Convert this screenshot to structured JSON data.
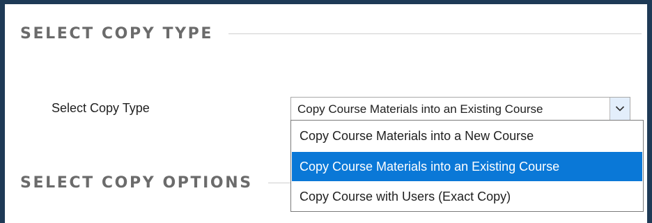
{
  "sections": {
    "copy_type_title": "SELECT COPY TYPE",
    "copy_options_title": "SELECT COPY OPTIONS"
  },
  "copy_type": {
    "label": "Select Copy Type",
    "selected_value": "Copy Course Materials into an Existing Course",
    "options": [
      "Copy Course Materials into a New Course",
      "Copy Course Materials into an Existing Course",
      "Copy Course with Users (Exact Copy)"
    ],
    "selected_index": 1
  },
  "icons": {
    "dropdown_arrow": "chevron-down-icon"
  },
  "colors": {
    "frame": "#1e3a56",
    "highlight": "#0a78d7",
    "section_title": "#6b6b6b"
  }
}
